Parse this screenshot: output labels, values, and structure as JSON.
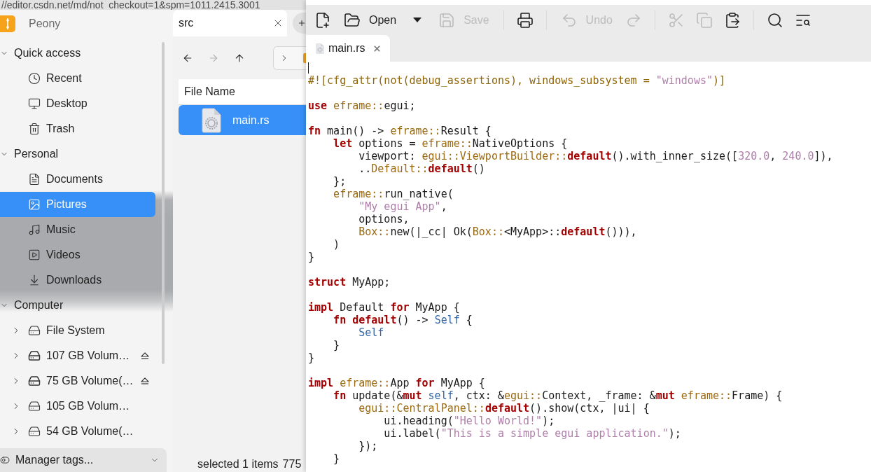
{
  "background": {
    "address": "//editor.csdn.net/md/not_checkout=1&spm=1011.2415.3001"
  },
  "sidebar": {
    "app_name": "Peony",
    "sections": [
      {
        "label": "Quick access",
        "expanded": true,
        "items": [
          {
            "kind": "recent",
            "label": "Recent",
            "selected": false
          },
          {
            "kind": "desktop",
            "label": "Desktop",
            "selected": false
          },
          {
            "kind": "trash",
            "label": "Trash",
            "selected": false
          }
        ]
      },
      {
        "label": "Personal",
        "expanded": true,
        "items": [
          {
            "kind": "documents",
            "label": "Documents",
            "selected": false
          },
          {
            "kind": "pictures",
            "label": "Pictures",
            "selected": true
          },
          {
            "kind": "music",
            "label": "Music",
            "selected": false
          },
          {
            "kind": "videos",
            "label": "Videos",
            "selected": false
          },
          {
            "kind": "downloads",
            "label": "Downloads",
            "selected": false
          }
        ]
      },
      {
        "label": "Computer",
        "expanded": true,
        "items": [
          {
            "kind": "drive",
            "label": "File System",
            "selected": false,
            "expanded": false,
            "ejectable": false
          },
          {
            "kind": "removable",
            "label": "107 GB Volum…",
            "selected": false,
            "expanded": false,
            "ejectable": true
          },
          {
            "kind": "removable",
            "label": "75 GB Volume(…",
            "selected": false,
            "expanded": false,
            "ejectable": true
          },
          {
            "kind": "drive",
            "label": "105 GB Volum…",
            "selected": false,
            "expanded": false,
            "ejectable": false
          },
          {
            "kind": "drive",
            "label": "54 GB Volume(…",
            "selected": false,
            "expanded": false,
            "ejectable": false
          }
        ]
      }
    ],
    "footer": {
      "label": "Manager tags...",
      "expanded": false
    }
  },
  "browser": {
    "tabs": [
      {
        "label": "src",
        "selected": true
      }
    ],
    "navigation": [
      {
        "kind": "back",
        "disabled": false
      },
      {
        "kind": "forward",
        "disabled": true
      },
      {
        "kind": "up",
        "disabled": false
      }
    ],
    "file_list": {
      "columns": [
        "File Name"
      ],
      "files": [
        {
          "name": "main.rs",
          "selected": true
        }
      ]
    },
    "status_bar": {
      "selection": "selected 1 items",
      "size": "775"
    }
  },
  "editor": {
    "toolbar": [
      {
        "kind": "new",
        "disabled": false
      },
      {
        "kind": "open",
        "label": "Open",
        "disabled": false
      },
      {
        "kind": "menu",
        "disabled": false
      },
      {
        "kind": "save",
        "label": "Save",
        "disabled": true
      },
      {
        "kind": "separator"
      },
      {
        "kind": "print",
        "disabled": false
      },
      {
        "kind": "separator"
      },
      {
        "kind": "undo",
        "label": "Undo",
        "disabled": true
      },
      {
        "kind": "redo",
        "disabled": true
      },
      {
        "kind": "separator"
      },
      {
        "kind": "cut",
        "disabled": true
      },
      {
        "kind": "copy",
        "disabled": true
      },
      {
        "kind": "paste",
        "disabled": false
      },
      {
        "kind": "separator"
      },
      {
        "kind": "find",
        "disabled": false
      },
      {
        "kind": "replace",
        "disabled": false
      }
    ],
    "tabs": [
      {
        "label": "main.rs",
        "selected": true
      }
    ],
    "code": {
      "lines": [
        {
          "kind": "blank",
          "caret": true
        },
        {
          "kind": "code",
          "tokens": [
            {
              "kind": "attr",
              "text": "#![cfg_attr(not(debug_assertions), windows_subsystem = "
            },
            {
              "kind": "string",
              "text": "\"windows\""
            },
            {
              "kind": "attr",
              "text": ")]"
            }
          ]
        },
        {
          "kind": "blank"
        },
        {
          "kind": "code",
          "tokens": [
            {
              "kind": "keyword",
              "text": "use"
            },
            {
              "kind": "path",
              "text": " eframe::"
            },
            {
              "kind": "plain",
              "text": "egui;"
            }
          ]
        },
        {
          "kind": "blank"
        },
        {
          "kind": "code",
          "tokens": [
            {
              "kind": "keyword",
              "text": "fn"
            },
            {
              "kind": "plain",
              "text": " main() -> "
            },
            {
              "kind": "path",
              "text": "eframe::"
            },
            {
              "kind": "plain",
              "text": "Result {"
            }
          ]
        },
        {
          "kind": "code",
          "tokens": [
            {
              "kind": "keyword",
              "text": "    let"
            },
            {
              "kind": "plain",
              "text": " options = "
            },
            {
              "kind": "path",
              "text": "eframe::"
            },
            {
              "kind": "plain",
              "text": "NativeOptions {"
            }
          ]
        },
        {
          "kind": "code",
          "tokens": [
            {
              "kind": "plain",
              "text": "        viewport: "
            },
            {
              "kind": "path",
              "text": "egui::ViewportBuilder::"
            },
            {
              "kind": "keyword",
              "text": "default"
            },
            {
              "kind": "plain",
              "text": "().with_inner_size(["
            },
            {
              "kind": "number",
              "text": "320.0"
            },
            {
              "kind": "plain",
              "text": ", "
            },
            {
              "kind": "number",
              "text": "240.0"
            },
            {
              "kind": "plain",
              "text": "]),"
            }
          ]
        },
        {
          "kind": "code",
          "tokens": [
            {
              "kind": "plain",
              "text": "        .."
            },
            {
              "kind": "path",
              "text": "Default::"
            },
            {
              "kind": "keyword",
              "text": "default"
            },
            {
              "kind": "plain",
              "text": "()"
            }
          ]
        },
        {
          "kind": "code",
          "tokens": [
            {
              "kind": "plain",
              "text": "    };"
            }
          ]
        },
        {
          "kind": "code",
          "tokens": [
            {
              "kind": "path",
              "text": "    eframe::"
            },
            {
              "kind": "plain",
              "text": "run_native("
            }
          ]
        },
        {
          "kind": "code",
          "tokens": [
            {
              "kind": "string",
              "text": "        \"My egui App\""
            },
            {
              "kind": "plain",
              "text": ","
            }
          ]
        },
        {
          "kind": "code",
          "tokens": [
            {
              "kind": "plain",
              "text": "        options,"
            }
          ]
        },
        {
          "kind": "code",
          "tokens": [
            {
              "kind": "path",
              "text": "        Box::"
            },
            {
              "kind": "plain",
              "text": "new(|_cc| Ok("
            },
            {
              "kind": "path",
              "text": "Box::"
            },
            {
              "kind": "plain",
              "text": "<MyApp>::"
            },
            {
              "kind": "keyword",
              "text": "default"
            },
            {
              "kind": "plain",
              "text": "())),"
            }
          ]
        },
        {
          "kind": "code",
          "tokens": [
            {
              "kind": "plain",
              "text": "    )"
            }
          ]
        },
        {
          "kind": "code",
          "tokens": [
            {
              "kind": "plain",
              "text": "}"
            }
          ]
        },
        {
          "kind": "blank"
        },
        {
          "kind": "code",
          "tokens": [
            {
              "kind": "keyword",
              "text": "struct"
            },
            {
              "kind": "plain",
              "text": " MyApp;"
            }
          ]
        },
        {
          "kind": "blank"
        },
        {
          "kind": "code",
          "tokens": [
            {
              "kind": "keyword",
              "text": "impl"
            },
            {
              "kind": "plain",
              "text": " Default "
            },
            {
              "kind": "keyword",
              "text": "for"
            },
            {
              "kind": "plain",
              "text": " MyApp {"
            }
          ]
        },
        {
          "kind": "code",
          "tokens": [
            {
              "kind": "keyword",
              "text": "    fn"
            },
            {
              "kind": "keyword",
              "text": " default"
            },
            {
              "kind": "plain",
              "text": "() -> "
            },
            {
              "kind": "self",
              "text": "Self"
            },
            {
              "kind": "plain",
              "text": " {"
            }
          ]
        },
        {
          "kind": "code",
          "tokens": [
            {
              "kind": "self",
              "text": "        Self"
            }
          ]
        },
        {
          "kind": "code",
          "tokens": [
            {
              "kind": "plain",
              "text": "    }"
            }
          ]
        },
        {
          "kind": "code",
          "tokens": [
            {
              "kind": "plain",
              "text": "}"
            }
          ]
        },
        {
          "kind": "blank"
        },
        {
          "kind": "code",
          "tokens": [
            {
              "kind": "keyword",
              "text": "impl"
            },
            {
              "kind": "path",
              "text": " eframe::"
            },
            {
              "kind": "plain",
              "text": "App "
            },
            {
              "kind": "keyword",
              "text": "for"
            },
            {
              "kind": "plain",
              "text": " MyApp {"
            }
          ]
        },
        {
          "kind": "code",
          "tokens": [
            {
              "kind": "keyword",
              "text": "    fn"
            },
            {
              "kind": "plain",
              "text": " update(&"
            },
            {
              "kind": "keyword",
              "text": "mut"
            },
            {
              "kind": "self",
              "text": " self"
            },
            {
              "kind": "plain",
              "text": ", ctx: &"
            },
            {
              "kind": "path",
              "text": "egui::"
            },
            {
              "kind": "plain",
              "text": "Context, _frame: &"
            },
            {
              "kind": "keyword",
              "text": "mut"
            },
            {
              "kind": "path",
              "text": " eframe::"
            },
            {
              "kind": "plain",
              "text": "Frame) {"
            }
          ]
        },
        {
          "kind": "code",
          "tokens": [
            {
              "kind": "path",
              "text": "        egui::CentralPanel::"
            },
            {
              "kind": "keyword",
              "text": "default"
            },
            {
              "kind": "plain",
              "text": "().show(ctx, |ui| {"
            }
          ]
        },
        {
          "kind": "code",
          "tokens": [
            {
              "kind": "plain",
              "text": "            ui.heading("
            },
            {
              "kind": "string",
              "text": "\"Hello World!\""
            },
            {
              "kind": "plain",
              "text": ");"
            }
          ]
        },
        {
          "kind": "code",
          "tokens": [
            {
              "kind": "plain",
              "text": "            ui.label("
            },
            {
              "kind": "string",
              "text": "\"This is a simple egui application.\""
            },
            {
              "kind": "plain",
              "text": ");"
            }
          ]
        },
        {
          "kind": "code",
          "tokens": [
            {
              "kind": "plain",
              "text": "        });"
            }
          ]
        },
        {
          "kind": "code",
          "tokens": [
            {
              "kind": "plain",
              "text": "    }"
            }
          ]
        }
      ]
    }
  }
}
